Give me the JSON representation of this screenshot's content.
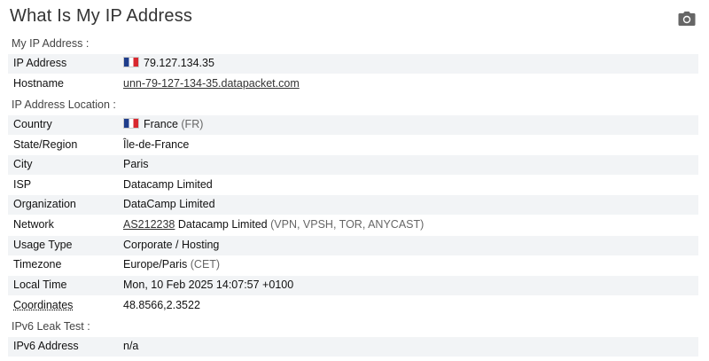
{
  "title": "What Is My IP Address",
  "sections": {
    "my_ip": "My IP Address :",
    "location": "IP Address Location :",
    "ipv6": "IPv6 Leak Test :"
  },
  "ip": {
    "label": "IP Address",
    "value": "79.127.134.35",
    "flag": "france-flag-icon"
  },
  "hostname": {
    "label": "Hostname",
    "value": "unn-79-127-134-35.datapacket.com"
  },
  "country": {
    "label": "Country",
    "value": "France",
    "code": "(FR)"
  },
  "region": {
    "label": "State/Region",
    "value": "Île-de-France"
  },
  "city": {
    "label": "City",
    "value": "Paris"
  },
  "isp": {
    "label": "ISP",
    "value": "Datacamp Limited"
  },
  "organization": {
    "label": "Organization",
    "value": "DataCamp Limited"
  },
  "network": {
    "label": "Network",
    "asn": "AS212238",
    "name": "Datacamp Limited",
    "tags": "(VPN, VPSH, TOR, ANYCAST)"
  },
  "usage": {
    "label": "Usage Type",
    "value": "Corporate / Hosting"
  },
  "timezone": {
    "label": "Timezone",
    "value": "Europe/Paris",
    "abbr": "(CET)"
  },
  "localtime": {
    "label": "Local Time",
    "value": "Mon, 10 Feb 2025 14:07:57 +0100"
  },
  "coordinates": {
    "label": "Coordinates",
    "value": "48.8566,2.3522"
  },
  "ipv6addr": {
    "label": "IPv6 Address",
    "value": "n/a"
  },
  "icons": {
    "screenshot": "camera-icon"
  }
}
